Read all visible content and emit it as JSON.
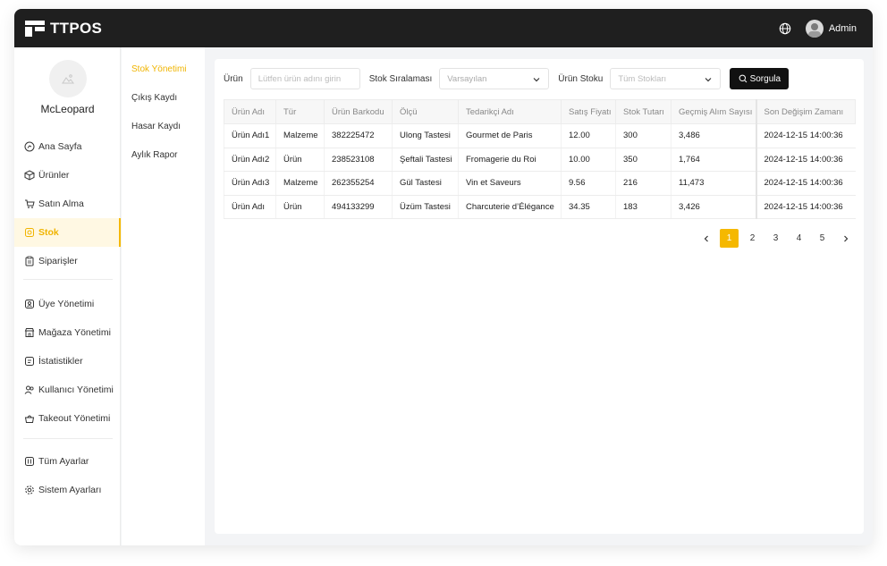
{
  "app": {
    "logo_text": "TTPOS"
  },
  "header": {
    "user_name": "Admin",
    "globe_icon": "globe-icon"
  },
  "profile": {
    "name": "McLeopard"
  },
  "sidebar": {
    "items": [
      {
        "label": "Ana Sayfa",
        "icon": "gauge-icon"
      },
      {
        "label": "Ürünler",
        "icon": "box-icon"
      },
      {
        "label": "Satın Alma",
        "icon": "cart-icon"
      },
      {
        "label": "Stok",
        "icon": "stock-icon",
        "active": true
      },
      {
        "label": "Siparişler",
        "icon": "clipboard-icon"
      },
      {
        "label": "Üye Yönetimi",
        "icon": "member-icon"
      },
      {
        "label": "Mağaza Yönetimi",
        "icon": "store-icon"
      },
      {
        "label": "İstatistikler",
        "icon": "stats-icon"
      },
      {
        "label": "Kullanıcı Yönetimi",
        "icon": "users-icon"
      },
      {
        "label": "Takeout Yönetimi",
        "icon": "takeout-icon"
      },
      {
        "label": "Tüm Ayarlar",
        "icon": "settings-grid-icon"
      },
      {
        "label": "Sistem Ayarları",
        "icon": "gear-icon"
      }
    ]
  },
  "subnav": {
    "items": [
      {
        "label": "Stok Yönetimi",
        "active": true
      },
      {
        "label": "Çıkış Kaydı"
      },
      {
        "label": "Hasar Kaydı"
      },
      {
        "label": "Aylık Rapor"
      }
    ]
  },
  "filters": {
    "product_label": "Ürün",
    "product_placeholder": "Lütfen ürün adını girin",
    "sort_label": "Stok Sıralaması",
    "sort_value": "Varsayılan",
    "stock_label": "Ürün Stoku",
    "stock_value": "Tüm Stokları",
    "search_label": "Sorgula"
  },
  "table": {
    "columns": [
      "Ürün Adı",
      "Tür",
      "Ürün Barkodu",
      "Ölçü",
      "Tedarikçi Adı",
      "Satış Fiyatı",
      "Stok Tutarı",
      "Geçmiş Alım Sayısı",
      "Son Değişim Zamanı"
    ],
    "rows": [
      [
        "Ürün Adı1",
        "Malzeme",
        "382225472",
        "Ulong Tastesi",
        "Gourmet de Paris",
        "12.00",
        "300",
        "3,486",
        "2024-12-15 14:00:36"
      ],
      [
        "Ürün Adı2",
        "Ürün",
        "238523108",
        "Şeftali Tastesi",
        "Fromagerie du Roi",
        "10.00",
        "350",
        "1,764",
        "2024-12-15 14:00:36"
      ],
      [
        "Ürün Adı3",
        "Malzeme",
        "262355254",
        "Gül Tastesi",
        "Vin et Saveurs",
        "9.56",
        "216",
        "11,473",
        "2024-12-15 14:00:36"
      ],
      [
        "Ürün Adı",
        "Ürün",
        "494133299",
        "Üzüm Tastesi",
        "Charcuterie d’Élégance",
        "34.35",
        "183",
        "3,426",
        "2024-12-15 14:00:36"
      ]
    ]
  },
  "pagination": {
    "pages": [
      "1",
      "2",
      "3",
      "4",
      "5"
    ],
    "current": "1"
  },
  "colors": {
    "accent": "#f5b800",
    "topbar": "#1f1f1f"
  }
}
